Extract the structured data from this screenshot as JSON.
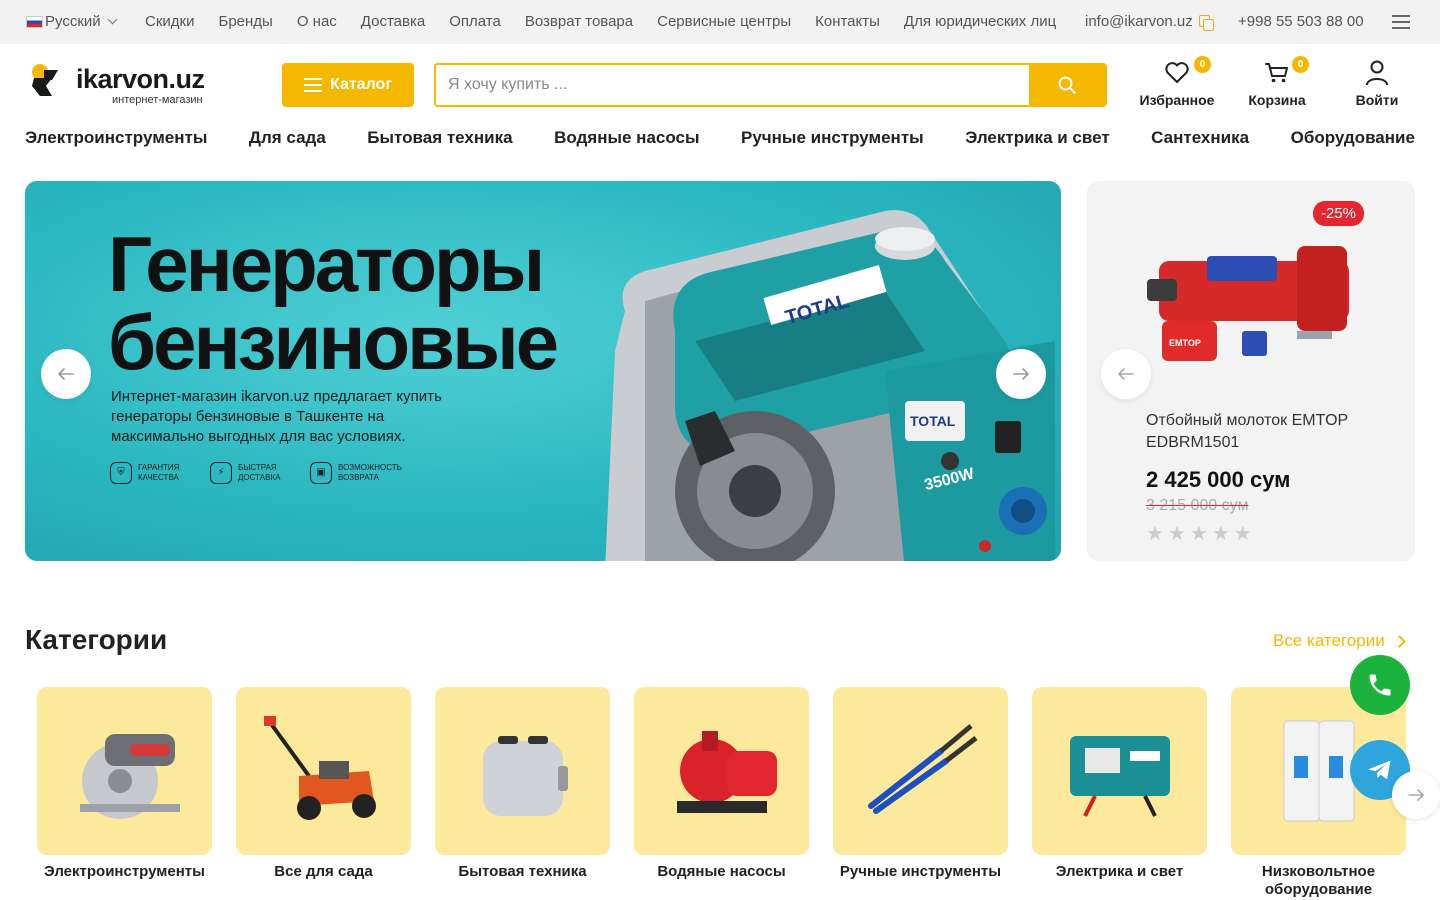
{
  "topbar": {
    "language": "Русский",
    "links": [
      "Скидки",
      "Бренды",
      "О нас",
      "Доставка",
      "Оплата",
      "Возврат товара",
      "Сервисные центры",
      "Контакты",
      "Для юридических лиц"
    ],
    "email": "info@ikarvon.uz",
    "phone": "+998 55 503 88 00"
  },
  "header": {
    "logo_text": "ikarvon.uz",
    "logo_sub": "интернет-магазин",
    "catalog_label": "Каталог",
    "search_placeholder": "Я хочу купить ...",
    "favorites_label": "Избранное",
    "favorites_count": "0",
    "cart_label": "Корзина",
    "cart_count": "0",
    "login_label": "Войти"
  },
  "catmenu": [
    "Электроинструменты",
    "Для сада",
    "Бытовая техника",
    "Водяные насосы",
    "Ручные инструменты",
    "Электрика и свет",
    "Сантехника",
    "Оборудование"
  ],
  "banner": {
    "title_line1": "Генераторы",
    "title_line2": "бензиновые",
    "description": "Интернет-магазин ikarvon.uz предлагает купить генераторы бензиновые в Ташкенте на максимально выгодных для вас условиях.",
    "features": [
      {
        "icon": "shield-icon",
        "label1": "ГАРАНТИЯ",
        "label2": "КАЧЕСТВА"
      },
      {
        "icon": "lightning-icon",
        "label1": "БЫСТРАЯ",
        "label2": "ДОСТАВКА"
      },
      {
        "icon": "box-icon",
        "label1": "ВОЗМОЖНОСТЬ",
        "label2": "ВОЗВРАТА"
      }
    ],
    "brand": "TOTAL",
    "model_power": "3500W"
  },
  "product": {
    "discount": "-25%",
    "name": "Отбойный молоток EMTOP EDBRM1501",
    "price": "2 425 000 сум",
    "old_price": "3 215 000 сум",
    "rating": 0,
    "brand_tag": "EMTOP"
  },
  "categories": {
    "title": "Категории",
    "all_label": "Все категории",
    "items": [
      {
        "label": "Электроинструменты",
        "icon": "circular-saw-icon"
      },
      {
        "label": "Все для сада",
        "icon": "lawn-mower-icon"
      },
      {
        "label": "Бытовая техника",
        "icon": "toaster-icon"
      },
      {
        "label": "Водяные насосы",
        "icon": "water-pump-icon"
      },
      {
        "label": "Ручные инструменты",
        "icon": "bolt-cutter-icon"
      },
      {
        "label": "Электрика и свет",
        "icon": "battery-charger-icon"
      },
      {
        "label": "Низковольтное оборудование",
        "icon": "circuit-breaker-icon"
      }
    ]
  },
  "colors": {
    "accent": "#f5b800",
    "banner_bg": "#2ab7c0",
    "discount": "#e52530",
    "category_bg": "#fde99b",
    "phone_fab": "#1bb33c",
    "telegram_fab": "#2ea6dd"
  }
}
